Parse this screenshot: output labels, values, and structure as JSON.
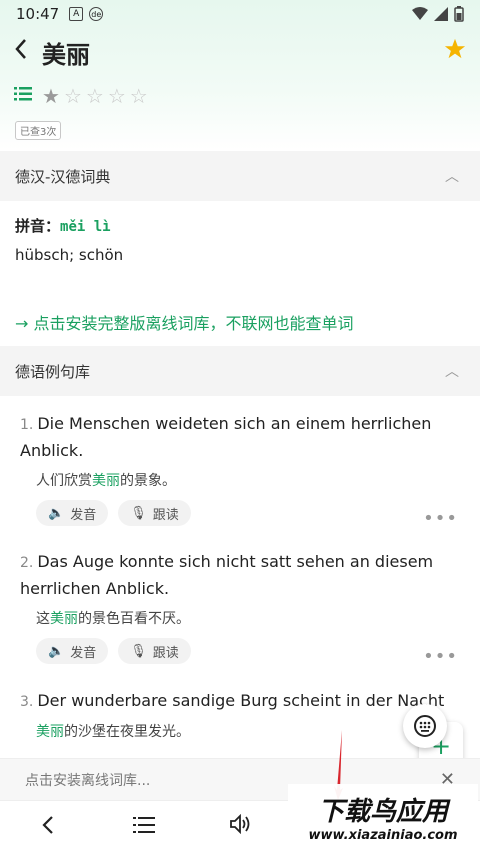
{
  "status": {
    "time": "10:47",
    "icon_a": "A",
    "icon_b": "de"
  },
  "header": {
    "word": "美丽",
    "back_icon": "chevron-left",
    "favorite_icon": "star"
  },
  "rating": {
    "filled": 1,
    "total": 5
  },
  "lookup_badge": "已查3次",
  "dictionary": {
    "title": "德汉-汉德词典",
    "pinyin_label": "拼音：",
    "pinyin": "měi lì",
    "meaning": "hübsch; schön",
    "install_link": "→ 点击安装完整版离线词库，不联网也能查单词"
  },
  "examples_section": {
    "title": "德语例句库"
  },
  "examples": [
    {
      "num": "1.",
      "en": "Die Menschen weideten sich an einem herrlichen Anblick.",
      "zh_pre": "人们欣赏",
      "zh_hl": "美丽",
      "zh_post": "的景象。",
      "speak": "发音",
      "follow": "跟读"
    },
    {
      "num": "2.",
      "en": "Das Auge konnte sich nicht satt sehen an diesem herrlichen Anblick.",
      "zh_pre": "这",
      "zh_hl": "美丽",
      "zh_post": "的景色百看不厌。",
      "speak": "发音",
      "follow": "跟读"
    },
    {
      "num": "3.",
      "en": "Der wunderbare sandige Burg scheint in der Nacht",
      "zh_pre": "",
      "zh_hl": "美丽",
      "zh_post": "的沙堡在夜里发光。"
    }
  ],
  "install_bar": {
    "text": "点击安装离线词库..."
  },
  "watermark": {
    "big": "下载鸟应用",
    "small": "www.xiazainiao.com"
  },
  "colors": {
    "accent": "#1aa060",
    "star": "#f5b400"
  }
}
